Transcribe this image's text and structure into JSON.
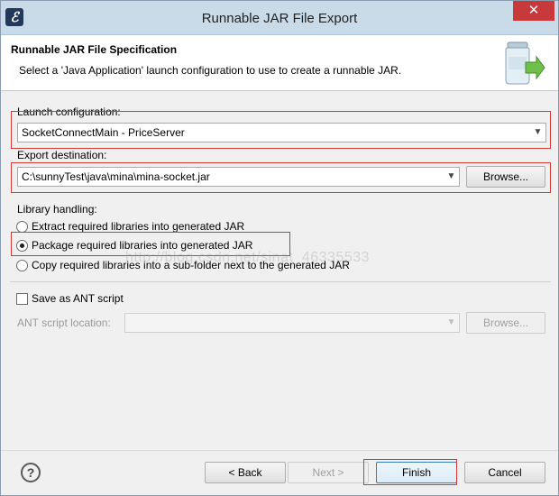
{
  "window": {
    "title": "Runnable JAR File Export",
    "close_glyph": "✕",
    "app_icon_glyph": "ℰ"
  },
  "banner": {
    "title": "Runnable JAR File Specification",
    "description": "Select a 'Java Application' launch configuration to use to create a runnable JAR."
  },
  "launch": {
    "label": "Launch configuration:",
    "value": "SocketConnectMain - PriceServer"
  },
  "export": {
    "label": "Export destination:",
    "value": "C:\\sunnyTest\\java\\mina\\mina-socket.jar",
    "browse_label": "Browse..."
  },
  "library": {
    "label": "Library handling:",
    "options": [
      {
        "label": "Extract required libraries into generated JAR",
        "checked": false
      },
      {
        "label": "Package required libraries into generated JAR",
        "checked": true
      },
      {
        "label": "Copy required libraries into a sub-folder next to the generated JAR",
        "checked": false
      }
    ]
  },
  "ant": {
    "checkbox_label": "Save as ANT script",
    "checked": false,
    "location_label": "ANT script location:",
    "location_value": "",
    "browse_label": "Browse..."
  },
  "watermark": "http://blog.csdn.net/sinat_46335533",
  "footer": {
    "help_glyph": "?",
    "back_label": "< Back",
    "next_label": "Next >",
    "finish_label": "Finish",
    "cancel_label": "Cancel"
  },
  "colors": {
    "titlebar": "#c9dbe9",
    "close": "#c7393a",
    "highlight": "#d23a3a"
  }
}
